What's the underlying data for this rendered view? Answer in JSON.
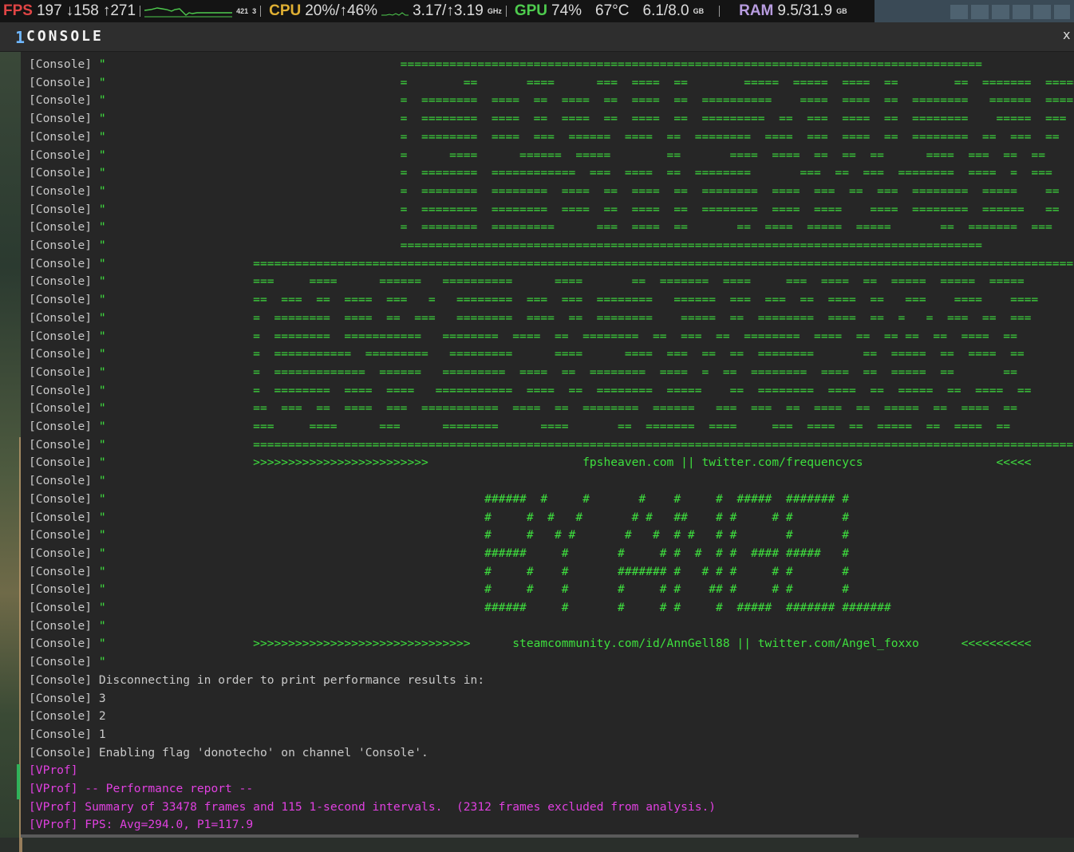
{
  "overlay": {
    "fps": {
      "label": "FPS",
      "value": "197",
      "min": "↓158",
      "max": "↑271",
      "spark_label": "421",
      "spark_label2": "3"
    },
    "cpu": {
      "label": "CPU",
      "value": "20%/↑46%",
      "clock": "3.17/↑3.19",
      "clock_unit": "GHz"
    },
    "gpu": {
      "label": "GPU",
      "value": "74%",
      "temp": "67°C",
      "vram": "6.1/8.0",
      "vram_unit": "GB"
    },
    "ram": {
      "label": "RAM",
      "value": "9.5/31.9",
      "unit": "GB"
    },
    "colors": {
      "fps": "#e04545",
      "cpu": "#e0b033",
      "gpu": "#4ecb4e",
      "ram": "#b89ce0"
    }
  },
  "console": {
    "title_icon": "1",
    "title": "CONSOLE",
    "close_label": "x",
    "prefix": "[Console]",
    "vprof_prefix": "[VProf]",
    "colors": {
      "prefix": "#c9c9c9",
      "art": "#3ee03e",
      "vprof": "#e040e0"
    },
    "art_lines": [
      "                                          ===================================================================================",
      "                                          =        ==       ====      ===  ====  ==        =====  =====  ====  ==        ==  =======  =====",
      "                                          =  ========  ====  ==  ====  ==  ====  ==  ==========    ====  ====  ==  ========   ======  ====",
      "                                          =  ========  ====  ==  ====  ==  ====  ==  =========  ==  ===  ====  ==  ========    =====  ===",
      "                                          =  ========  ====  ===  ======  ====  ==  ========  ====  ===  ====  ==  ========  ==  ===  ==",
      "                                          =      ====      ======  =====        ==       ====  ====  ==  ==  ==      ====  ===  ==  ==",
      "                                          =  ========  ============  ===  ====  ==  ========       ===  ==  ===  ========  ====  =  ===",
      "                                          =  ========  ========  ====  ==  ====  ==  ========  ====  ===  ==  ===  ========  =====    ==",
      "                                          =  ========  ========  ====  ==  ====  ==  ========  ====  ====    ====  ========  ======   ==",
      "                                          =  ========  =========      ===  ====  ==       ==  ====  =====  =====       ==  =======  ===",
      "                                          ===================================================================================",
      "                     =====================================================================================================================",
      "                     ===     ====      ======   ==========      ====       ==  =======  ====     ===  ====  ==  =====  =====  =====",
      "                     ==  ===  ==  ====  ===   =   ========  ===  ===  ========   ======  ===  ===  ==  ====  ==   ===    ====    ====",
      "                     =  ========  ====  ==  ===   ========  ====  ==  ========    =====  ==  ========  ====  ==  =   =  ===  ==  ===",
      "                     =  ========  ===========   ========  ====  ==  ========  ==  ===  ==  ========  ====  ==  == ==  ==  ====  ==",
      "                     =  ===========  =========   =========      ====      ====  ===  ==  ==  ========       ==  =====  ==  ====  ==",
      "                     =  =============  ======   =========  ====  ==  ========  ====  =  ==  ========  ====  ==  =====  ==       ==",
      "                     =  ========  ====  ====   ===========  ====  ==  ========  =====    ==  ========  ====  ==  =====  ==  ====  ==",
      "                     ==  ===  ==  ====  ===  ===========  ====  ==  ========  ======   ===  ===  ==  ====  ==  =====  ==  ====  ==",
      "                     ===     ====      ===      ========      ====       ==  =======  ====     ===  ====  ==  =====  ==  ====  ==",
      "                     =====================================================================================================================",
      "                     >>>>>>>>>>>>>>>>>>>>>>>>>                      fpsheaven.com || twitter.com/frequencycs                   <<<<<",
      "",
      "                                                      ######  #     #       #    #     #  #####  ####### #",
      "                                                      #     #  #   #       # #   ##    # #     # #       #",
      "                                                      #     #   # #       #   #  # #   # #       #       #",
      "                                                      ######     #       #     # #  #  # #  #### #####   #",
      "                                                      #     #    #       ####### #   # # #     # #       #",
      "                                                      #     #    #       #     # #    ## #     # #       #",
      "                                                      ######     #       #     # #     #  #####  ####### #######",
      "",
      "                     >>>>>>>>>>>>>>>>>>>>>>>>>>>>>>>      steamcommunity.com/id/AnnGell88 || twitter.com/Angel_foxxo      <<<<<<<<<<",
      ""
    ],
    "messages": [
      "Disconnecting in order to print performance results in:",
      "3",
      "2",
      "1",
      "Enabling flag 'donotecho' on channel 'Console'."
    ],
    "vprof_messages": [
      "",
      "-- Performance report --",
      "Summary of 33478 frames and 115 1-second intervals.  (2312 frames excluded from analysis.)",
      "FPS: Avg=294.0, P1=117.9"
    ]
  }
}
